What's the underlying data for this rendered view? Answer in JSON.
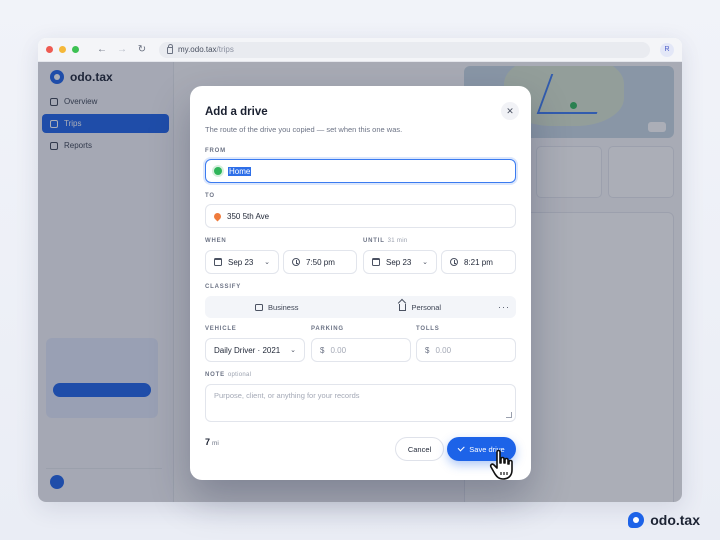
{
  "browser": {
    "url_host": "my.odo.tax",
    "url_path": "/trips",
    "profile_initial": "R"
  },
  "app": {
    "brand": "odo.tax",
    "sidebar": {
      "items": [
        {
          "label": "Overview",
          "active": false
        },
        {
          "label": "Trips",
          "active": true
        },
        {
          "label": "Reports",
          "active": false
        }
      ]
    }
  },
  "modal": {
    "title": "Add a drive",
    "subtitle": "The route of the drive you copied — set when this one was.",
    "from": {
      "label": "FROM",
      "value": "Home"
    },
    "to": {
      "label": "TO",
      "value": "350 5th Ave"
    },
    "when": {
      "label": "WHEN",
      "date": "Sep 23",
      "time": "7:50 pm"
    },
    "until": {
      "label": "UNTIL",
      "hint": "31 min",
      "date": "Sep 23",
      "time": "8:21 pm"
    },
    "classify": {
      "label": "CLASSIFY",
      "options": [
        {
          "label": "Business",
          "icon": "briefcase-icon"
        },
        {
          "label": "Personal",
          "icon": "home-icon"
        }
      ],
      "more": "···"
    },
    "vehicle": {
      "label": "VEHICLE",
      "value": "Daily Driver · 2021"
    },
    "parking": {
      "label": "PARKING",
      "currency": "$",
      "placeholder": "0.00"
    },
    "tolls": {
      "label": "TOLLS",
      "currency": "$",
      "placeholder": "0.00"
    },
    "note": {
      "label": "NOTE",
      "optional": "optional",
      "placeholder": "Purpose, client, or anything for your records"
    },
    "distance": {
      "value": "7",
      "unit": "mi"
    },
    "cancel_label": "Cancel",
    "save_label": "Save drive"
  },
  "footer": {
    "brand": "odo.tax"
  },
  "colors": {
    "accent": "#1d63e8",
    "from_dot": "#2fb55a",
    "to_pin": "#ef7b3c"
  }
}
